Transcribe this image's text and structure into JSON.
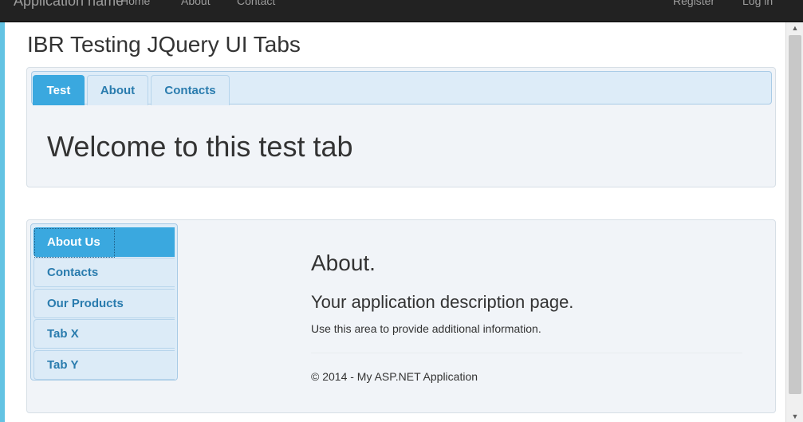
{
  "navbar": {
    "brand": "Application name",
    "links": [
      "Home",
      "About",
      "Contact"
    ],
    "right_links": [
      "Register",
      "Log in"
    ]
  },
  "page": {
    "title": "IBR Testing JQuery UI Tabs"
  },
  "top_tabs": {
    "tabs": [
      "Test",
      "About",
      "Contacts"
    ],
    "active_index": 0,
    "panel_text": "Welcome to this test tab"
  },
  "side_tabs": {
    "tabs": [
      "About Us",
      "Contacts",
      "Our Products",
      "Tab X",
      "Tab Y"
    ],
    "active_index": 0,
    "content": {
      "heading": "About.",
      "subheading": "Your application description page.",
      "paragraph": "Use this area to provide additional information.",
      "footer": "© 2014 - My ASP.NET Application"
    }
  },
  "colors": {
    "accent": "#3aa8df",
    "tab_text": "#2a7cae",
    "navbar": "#222222",
    "window_frame": "#63c3e3"
  },
  "icons": {
    "scroll_up": "scroll-up-arrow-icon",
    "scroll_down": "scroll-down-arrow-icon"
  }
}
